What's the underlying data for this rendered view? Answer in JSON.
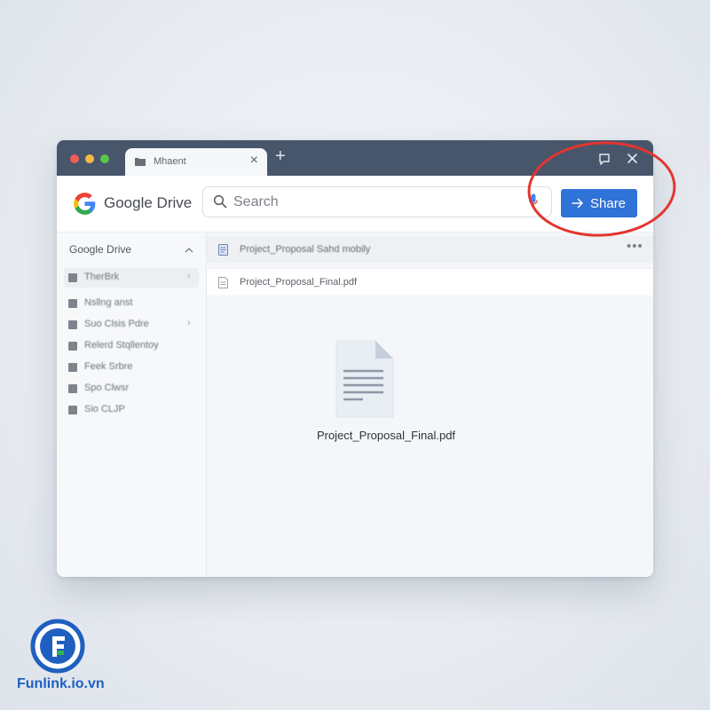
{
  "browser": {
    "tab_title": "Mhaent",
    "new_tab_symbol": "+",
    "close_symbol": "×"
  },
  "toolbar": {
    "brand": "Google Drive",
    "search_placeholder": "Search",
    "share_label": "Share"
  },
  "sidebar": {
    "title": "Google Drive",
    "items": [
      {
        "label": "TherBrk",
        "icon": "drive-icon",
        "active": true,
        "chevron": true
      },
      {
        "label": "Nsllng anst",
        "icon": "person-icon"
      },
      {
        "label": "Suo Clsis Pdre",
        "icon": "computer-icon",
        "chevron": true
      },
      {
        "label": "Relerd Stqllentoy",
        "icon": "shared-icon"
      },
      {
        "label": "Feek Srbre",
        "icon": "starred-icon"
      },
      {
        "label": "Spo Clwsr",
        "icon": "trash-icon"
      },
      {
        "label": "Sio CLJP",
        "icon": "storage-icon"
      }
    ]
  },
  "files": {
    "rows": [
      {
        "label": "Project_Proposal Sahd mobily"
      },
      {
        "label": "Project_Proposal_Final.pdf"
      }
    ],
    "preview_name": "Project_Proposal_Final.pdf"
  },
  "watermark": {
    "text": "Funlink.io.vn"
  },
  "colors": {
    "titlebar": "#48566c",
    "share_button": "#2f72d8",
    "annotation_circle": "#e3352f",
    "watermark": "#1f5fc0"
  }
}
